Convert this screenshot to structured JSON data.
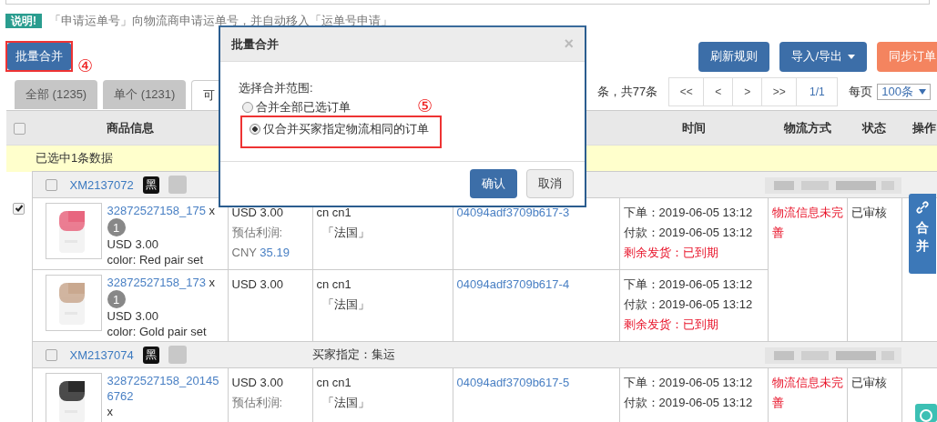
{
  "notice": {
    "badge": "说明!",
    "text": "「申请运单号」向物流商申请运单号，并自动移入「运单号申请」"
  },
  "toolbar": {
    "left_button": {
      "label": "批量合并",
      "highlighted": true,
      "marker": "④"
    },
    "right_buttons": [
      {
        "label": "刷新规则",
        "kind": "primary"
      },
      {
        "label": "导入/导出",
        "kind": "dropdown"
      },
      {
        "label": "同步订单",
        "kind": "warning"
      }
    ]
  },
  "tabs": [
    {
      "label": "全部 (1235)",
      "selected": false
    },
    {
      "label": "单个 (1231)",
      "selected": false
    },
    {
      "label": "可",
      "selected": true
    }
  ],
  "pagination": {
    "summary": "条，共77条",
    "buttons": [
      "<<",
      "<",
      ">",
      ">>"
    ],
    "page": "1/1",
    "per_page_label": "每页",
    "per_page": "100条"
  },
  "table": {
    "header": {
      "checked": false,
      "product": "商品信息",
      "time": "时间",
      "logistics": "物流方式",
      "status": "状态",
      "action": "操作"
    },
    "selection_bar": "已选中1条数据",
    "groups": [
      {
        "checked": true,
        "inner_checked": false,
        "order_no": "XM2137072",
        "tag": "黑",
        "logistics": "物流信息未完善",
        "status": "已审核",
        "items": [
          {
            "sku": "32872527158_175",
            "times_sign": "x",
            "qty": "1",
            "unit_price": "USD 3.00",
            "variant": "color:  Red pair set",
            "price": "USD 3.00",
            "profit_label": "预估利润:",
            "profit_currency": "CNY",
            "profit": "35.19",
            "ship_name": "cn cn1",
            "country": "「法国」",
            "order_id": "04094adf3709b617-3",
            "ordered": "下单：2019-06-05 13:12",
            "paid": "付款：2019-06-05 13:12",
            "remaining": "剩余发货：已到期"
          },
          {
            "sku": "32872527158_173",
            "times_sign": "x",
            "qty": "1",
            "unit_price": "USD 3.00",
            "variant": "color:  Gold pair set",
            "price": "USD 3.00",
            "ship_name": "cn cn1",
            "country": "「法国」",
            "order_id": "04094adf3709b617-4",
            "ordered": "下单：2019-06-05 13:12",
            "paid": "付款：2019-06-05 13:12",
            "remaining": "剩余发货：已到期"
          }
        ]
      },
      {
        "inner_checked": false,
        "order_no": "XM2137074",
        "tag": "黑",
        "buyer_note": "买家指定：集运",
        "logistics": "物流信息未完善",
        "status": "已审核",
        "items": [
          {
            "sku": "32872527158_201456762",
            "times_sign": "x",
            "price": "USD 3.00",
            "profit_label": "预估利润:",
            "ship_name": "cn cn1",
            "country": "「法国」",
            "order_id": "04094adf3709b617-5",
            "ordered": "下单：2019-06-05 13:12",
            "paid": "付款：2019-06-05 13:12"
          }
        ]
      }
    ]
  },
  "modal": {
    "title": "批量合并",
    "close": "×",
    "prompt": "选择合并范围:",
    "marker": "⑤",
    "options": [
      {
        "label": "合并全部已选订单",
        "selected": false,
        "highlighted": false
      },
      {
        "label": "仅合并买家指定物流相同的订单",
        "selected": true,
        "highlighted": true
      }
    ],
    "confirm": "确认",
    "cancel": "取消"
  },
  "side_button": {
    "label": "合并"
  }
}
